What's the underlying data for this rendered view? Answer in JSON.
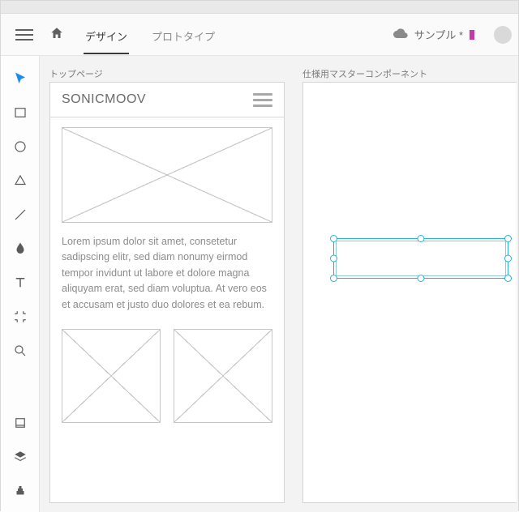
{
  "menubar": {
    "tabs": {
      "design": "デザイン",
      "prototype": "プロトタイプ"
    },
    "doc_title": "サンプル *"
  },
  "artboards": {
    "a1": {
      "label": "トップページ"
    },
    "a2": {
      "label": "仕様用マスターコンポーネント"
    }
  },
  "wireframe": {
    "brand": "SONICMOOV",
    "paragraph": "Lorem ipsum dolor sit amet, consetetur sadipscing elitr, sed diam nonumy eirmod tempor invidunt ut labore et dolore magna aliquyam erat, sed diam voluptua. At vero eos et accusam et justo duo dolores et ea rebum."
  },
  "tools": {
    "select": "select",
    "rectangle": "rectangle",
    "ellipse": "ellipse",
    "polygon": "polygon",
    "line": "line",
    "pen": "pen",
    "text": "text",
    "artboard": "artboard",
    "zoom": "zoom",
    "assets": "assets",
    "layers": "layers",
    "plugins": "plugins"
  },
  "colors": {
    "accent": "#1c8cf0",
    "selection": "#27b2d8"
  }
}
